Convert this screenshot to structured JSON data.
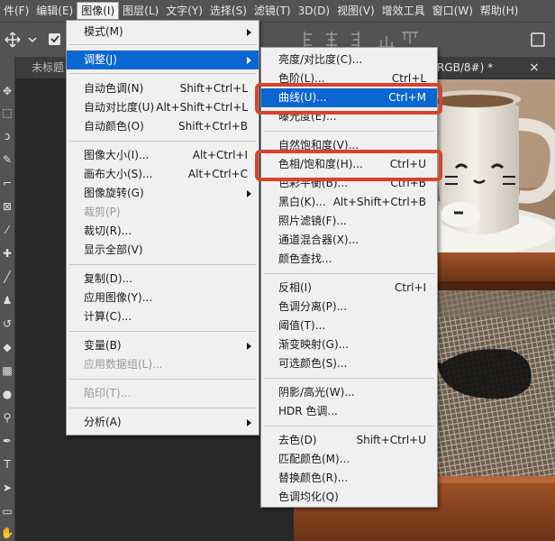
{
  "menubar": {
    "items": [
      {
        "label": "件(F)"
      },
      {
        "label": "编辑(E)"
      },
      {
        "label": "图像(I)",
        "active": true
      },
      {
        "label": "图层(L)"
      },
      {
        "label": "文字(Y)"
      },
      {
        "label": "选择(S)"
      },
      {
        "label": "滤镜(T)"
      },
      {
        "label": "3D(D)"
      },
      {
        "label": "视图(V)"
      },
      {
        "label": "增效工具"
      },
      {
        "label": "窗口(W)"
      },
      {
        "label": "帮助(H)"
      }
    ]
  },
  "doc_tabs": {
    "left_tab": "未标题",
    "right_tab": "RGB/8#) *",
    "close_glyph": "×"
  },
  "image_menu": {
    "items": [
      {
        "label": "模式(M)",
        "shortcut": "",
        "submenu": true
      },
      {
        "label": "调整(J)",
        "shortcut": "",
        "submenu": true,
        "highlighted": true
      },
      {
        "label": "自动色调(N)",
        "shortcut": "Shift+Ctrl+L"
      },
      {
        "label": "自动对比度(U)",
        "shortcut": "Alt+Shift+Ctrl+L"
      },
      {
        "label": "自动颜色(O)",
        "shortcut": "Shift+Ctrl+B"
      },
      {
        "label": "图像大小(I)...",
        "shortcut": "Alt+Ctrl+I"
      },
      {
        "label": "画布大小(S)...",
        "shortcut": "Alt+Ctrl+C"
      },
      {
        "label": "图像旋转(G)",
        "shortcut": "",
        "submenu": true
      },
      {
        "label": "裁剪(P)",
        "shortcut": "",
        "disabled": true
      },
      {
        "label": "裁切(R)...",
        "shortcut": ""
      },
      {
        "label": "显示全部(V)",
        "shortcut": ""
      },
      {
        "label": "复制(D)...",
        "shortcut": ""
      },
      {
        "label": "应用图像(Y)...",
        "shortcut": ""
      },
      {
        "label": "计算(C)...",
        "shortcut": ""
      },
      {
        "label": "变量(B)",
        "shortcut": "",
        "submenu": true
      },
      {
        "label": "应用数据组(L)...",
        "shortcut": "",
        "disabled": true
      },
      {
        "label": "陷印(T)...",
        "shortcut": "",
        "disabled": true
      },
      {
        "label": "分析(A)",
        "shortcut": "",
        "submenu": true
      }
    ]
  },
  "adjust_menu": {
    "items": [
      {
        "label": "亮度/对比度(C)...",
        "shortcut": ""
      },
      {
        "label": "色阶(L)...",
        "shortcut": "Ctrl+L"
      },
      {
        "label": "曲线(U)...",
        "shortcut": "Ctrl+M",
        "highlighted": true
      },
      {
        "label": "曝光度(E)...",
        "shortcut": ""
      },
      {
        "label": "自然饱和度(V)...",
        "shortcut": ""
      },
      {
        "label": "色相/饱和度(H)...",
        "shortcut": "Ctrl+U"
      },
      {
        "label": "色彩平衡(B)...",
        "shortcut": "Ctrl+B"
      },
      {
        "label": "黑白(K)...",
        "shortcut": "Alt+Shift+Ctrl+B"
      },
      {
        "label": "照片滤镜(F)...",
        "shortcut": ""
      },
      {
        "label": "通道混合器(X)...",
        "shortcut": ""
      },
      {
        "label": "颜色查找...",
        "shortcut": ""
      },
      {
        "label": "反相(I)",
        "shortcut": "Ctrl+I"
      },
      {
        "label": "色调分离(P)...",
        "shortcut": ""
      },
      {
        "label": "阈值(T)...",
        "shortcut": ""
      },
      {
        "label": "渐变映射(G)...",
        "shortcut": ""
      },
      {
        "label": "可选颜色(S)...",
        "shortcut": ""
      },
      {
        "label": "阴影/高光(W)...",
        "shortcut": ""
      },
      {
        "label": "HDR 色调...",
        "shortcut": ""
      },
      {
        "label": "去色(D)",
        "shortcut": "Shift+Ctrl+U"
      },
      {
        "label": "匹配颜色(M)...",
        "shortcut": ""
      },
      {
        "label": "替换颜色(R)...",
        "shortcut": ""
      },
      {
        "label": "色调均化(Q)",
        "shortcut": ""
      }
    ]
  },
  "tools": {
    "icons": [
      "move-icon",
      "marquee-icon",
      "lasso-icon",
      "quick-select-icon",
      "crop-icon",
      "frame-icon",
      "eyedropper-icon",
      "healing-icon",
      "brush-icon",
      "stamp-icon",
      "history-brush-icon",
      "eraser-icon",
      "gradient-icon",
      "blur-icon",
      "dodge-icon",
      "pen-icon",
      "type-icon",
      "path-select-icon",
      "shape-icon",
      "hand-icon"
    ]
  },
  "colors": {
    "highlight": "#0a66d0",
    "annotation": "#d8432a",
    "menu_bg": "#f0f0f0",
    "chrome": "#535353"
  }
}
